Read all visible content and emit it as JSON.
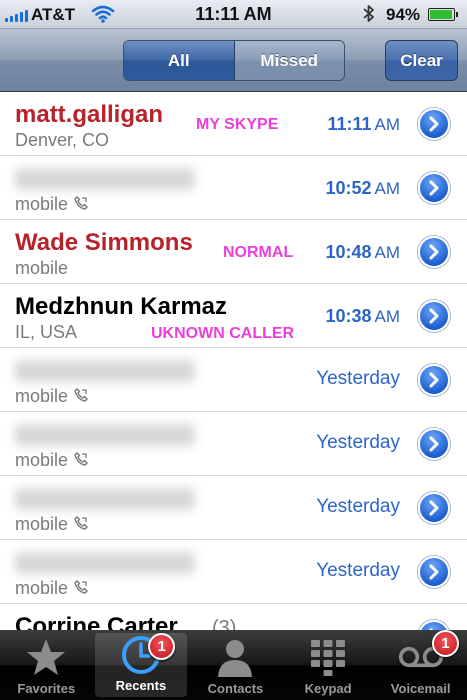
{
  "status_bar": {
    "carrier": "AT&T",
    "time": "11:11 AM",
    "battery_text": "94%",
    "battery_level": 0.94,
    "icons": [
      "signal-bars-icon",
      "wifi-icon",
      "bluetooth-icon",
      "battery-icon"
    ]
  },
  "nav": {
    "segments": [
      "All",
      "Missed"
    ],
    "selected_segment": "All",
    "clear_label": "Clear"
  },
  "calls": [
    {
      "name": "matt.galligan",
      "missed": true,
      "blurred": false,
      "detail": "Denver, CO",
      "show_phone_icon": false,
      "time": "11:11",
      "ampm": "AM",
      "annotation": "MY SKYPE"
    },
    {
      "name": "Corrine Carter",
      "missed": false,
      "blurred": true,
      "detail": "mobile",
      "show_phone_icon": true,
      "time": "10:52",
      "ampm": "AM",
      "annotation": ""
    },
    {
      "name": "Wade Simmons",
      "missed": true,
      "blurred": false,
      "detail": "mobile",
      "show_phone_icon": false,
      "time": "10:48",
      "ampm": "AM",
      "annotation": "NORMAL"
    },
    {
      "name": "Medzhnun Karmaz",
      "missed": false,
      "blurred": false,
      "detail": "IL, USA",
      "show_phone_icon": false,
      "time": "10:38",
      "ampm": "AM",
      "annotation": "UKNOWN CALLER"
    },
    {
      "name": "Corrine Carter",
      "missed": false,
      "blurred": true,
      "detail": "mobile",
      "show_phone_icon": true,
      "time": "Yesterday",
      "ampm": "",
      "annotation": ""
    },
    {
      "name": "Nancy Galligan",
      "missed": false,
      "blurred": true,
      "detail": "mobile",
      "show_phone_icon": true,
      "time": "Yesterday",
      "ampm": "",
      "annotation": ""
    },
    {
      "name": "Josh Mitchell",
      "missed": false,
      "blurred": true,
      "detail": "mobile",
      "show_phone_icon": true,
      "time": "Yesterday",
      "ampm": "",
      "annotation": ""
    },
    {
      "name": "Ryan Galligan",
      "missed": false,
      "blurred": true,
      "detail": "mobile",
      "show_phone_icon": true,
      "time": "Yesterday",
      "ampm": "",
      "annotation": ""
    },
    {
      "name": "Corrine Carter",
      "missed": false,
      "blurred": false,
      "detail": "",
      "show_phone_icon": false,
      "time": "",
      "ampm": "",
      "annotation": "",
      "count": "(3)"
    }
  ],
  "tabs": [
    {
      "label": "Favorites",
      "icon": "star-icon",
      "active": false,
      "badge": ""
    },
    {
      "label": "Recents",
      "icon": "clock-icon",
      "active": true,
      "badge": "1"
    },
    {
      "label": "Contacts",
      "icon": "person-icon",
      "active": false,
      "badge": ""
    },
    {
      "label": "Keypad",
      "icon": "keypad-icon",
      "active": false,
      "badge": ""
    },
    {
      "label": "Voicemail",
      "icon": "voicemail-icon",
      "active": false,
      "badge": "1"
    }
  ],
  "colors": {
    "missed": "#b8232b",
    "time": "#2d64c8",
    "annotation": "#ea3fd9",
    "disclosure": "#1d5fd2"
  }
}
